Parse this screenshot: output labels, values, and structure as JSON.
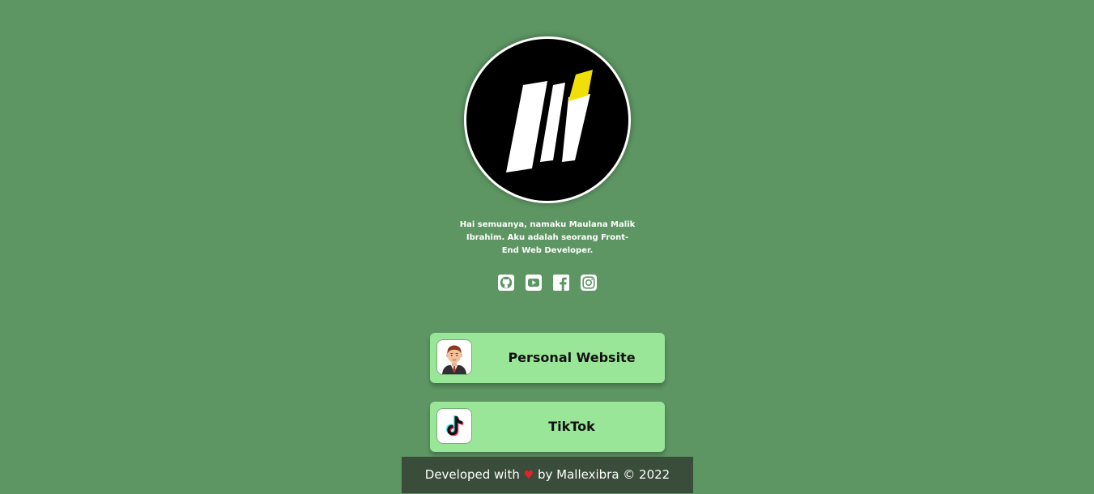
{
  "profile": {
    "avatar_icon": "mi-logo-icon",
    "bio": "Hai semuanya, namaku Maulana Malik Ibrahim. Aku adalah seorang Front-End Web Developer."
  },
  "socials": [
    {
      "icon": "github-icon"
    },
    {
      "icon": "youtube-icon"
    },
    {
      "icon": "facebook-icon"
    },
    {
      "icon": "instagram-icon"
    }
  ],
  "links": [
    {
      "label": "Personal Website",
      "icon": "man-avatar-icon"
    },
    {
      "label": "TikTok",
      "icon": "tiktok-icon"
    }
  ],
  "footer": {
    "prefix": "Developed with",
    "heart": "♥",
    "suffix": "by Mallexibra © 2022"
  },
  "colors": {
    "background": "#5d9663",
    "card": "#99e699",
    "footer": "#3a4c3a",
    "logo_accent": "#f2df0a",
    "heart": "#e8202a"
  }
}
